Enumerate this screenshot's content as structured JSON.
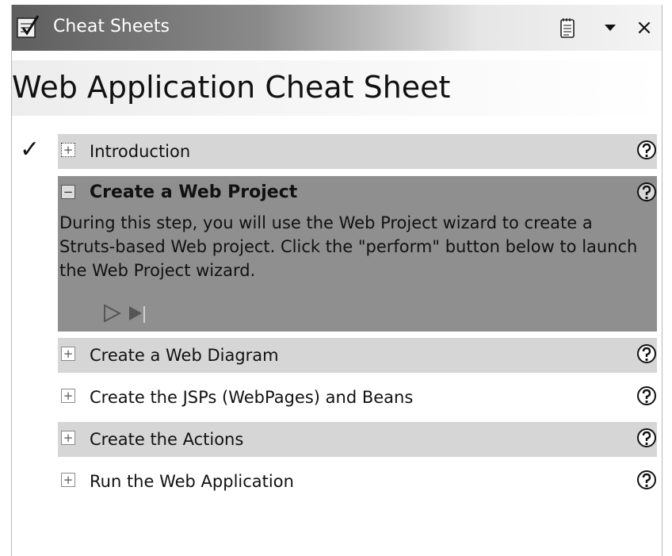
{
  "window": {
    "title": "Cheat Sheets",
    "app_icon": "cheat-sheet-icon",
    "buttons": [
      {
        "name": "view-menu-icon",
        "icon": "notepad-icon"
      },
      {
        "name": "dropdown-icon",
        "icon": "triangle-down-icon"
      },
      {
        "name": "close-icon",
        "icon": "close-icon",
        "glyph": "×"
      }
    ]
  },
  "sheet": {
    "title": "Web Application Cheat Sheet"
  },
  "steps": [
    {
      "label": "Introduction",
      "expander": "+",
      "completed": true
    },
    {
      "label": "Create a Web Project",
      "expander": "−",
      "expanded": true,
      "description": "During this step, you will use the Web Project wizard to create a Struts-based Web project.  Click the \"perform\" button below to launch the Web Project wizard."
    },
    {
      "label": "Create a Web Diagram",
      "expander": "+"
    },
    {
      "label": "Create the JSPs (WebPages) and Beans",
      "expander": "+"
    },
    {
      "label": "Create the Actions",
      "expander": "+"
    },
    {
      "label": "Run the Web Application",
      "expander": "+"
    }
  ],
  "icons": {
    "check": "✓",
    "help": "help-icon",
    "perform": "perform-icon",
    "skip": "skip-icon"
  },
  "colors": {
    "titlebar_dark": "#5e5e5e",
    "row_shaded": "#d6d6d6",
    "expanded_bg": "#8f8f8f"
  }
}
